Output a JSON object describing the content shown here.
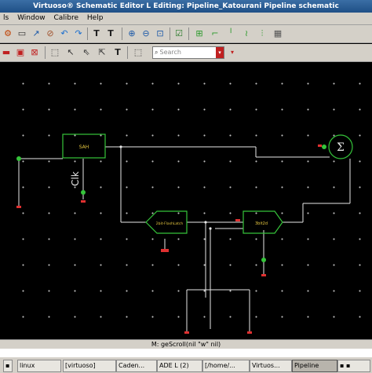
{
  "window": {
    "title": "Virtuoso® Schematic Editor L Editing: Pipeline_Katourani Pipeline schematic"
  },
  "menu": [
    "ls",
    "Window",
    "Calibre",
    "Help"
  ],
  "search": {
    "placeholder": "Search"
  },
  "status": {
    "message": "M: geScroll(nil \"w\" nil)"
  },
  "taskbar": [
    {
      "label": "linux"
    },
    {
      "label": "[virtuoso]"
    },
    {
      "label": "Caden..."
    },
    {
      "label": "ADE L (2)"
    },
    {
      "label": "[/home/..."
    },
    {
      "label": "Virtuos..."
    },
    {
      "label": "Pipeline"
    }
  ],
  "schematic": {
    "blocks": {
      "sah": "SAH",
      "adc": "2bit-FlashLatch",
      "dac": "3bit2d",
      "sum": "Σ"
    },
    "labels": {
      "clk": "Clk"
    }
  }
}
